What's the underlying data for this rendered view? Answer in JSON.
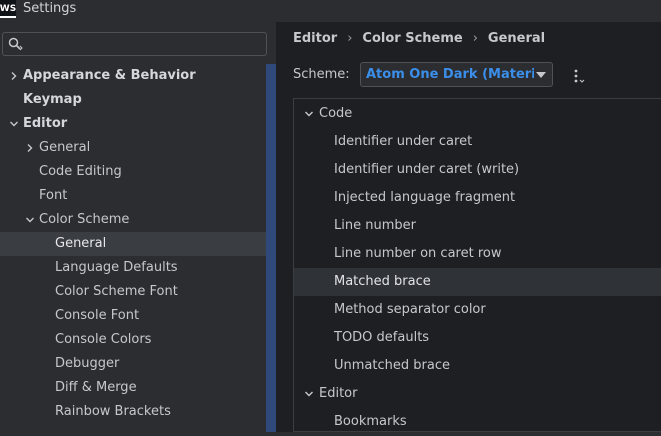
{
  "window": {
    "title": "Settings",
    "logo_text": "WS"
  },
  "search": {
    "placeholder": "",
    "value": ""
  },
  "tree": [
    {
      "label": "Appearance & Behavior",
      "bold": true,
      "chevron": "right"
    },
    {
      "label": "Keymap",
      "bold": true,
      "chevron": ""
    },
    {
      "label": "Editor",
      "bold": true,
      "chevron": "down"
    },
    {
      "label": "General",
      "bold": false,
      "chevron": "right"
    },
    {
      "label": "Code Editing",
      "bold": false,
      "chevron": ""
    },
    {
      "label": "Font",
      "bold": false,
      "chevron": ""
    },
    {
      "label": "Color Scheme",
      "bold": false,
      "chevron": "down"
    },
    {
      "label": "General",
      "bold": false,
      "chevron": "",
      "selected": true
    },
    {
      "label": "Language Defaults",
      "bold": false,
      "chevron": ""
    },
    {
      "label": "Color Scheme Font",
      "bold": false,
      "chevron": ""
    },
    {
      "label": "Console Font",
      "bold": false,
      "chevron": ""
    },
    {
      "label": "Console Colors",
      "bold": false,
      "chevron": ""
    },
    {
      "label": "Debugger",
      "bold": false,
      "chevron": ""
    },
    {
      "label": "Diff & Merge",
      "bold": false,
      "chevron": ""
    },
    {
      "label": "Rainbow Brackets",
      "bold": false,
      "chevron": ""
    }
  ],
  "breadcrumb": [
    "Editor",
    "Color Scheme",
    "General"
  ],
  "scheme": {
    "label": "Scheme:",
    "value": "Atom One Dark (Material"
  },
  "sections": [
    {
      "label": "Code",
      "type": "group"
    },
    {
      "label": "Identifier under caret",
      "type": "item"
    },
    {
      "label": "Identifier under caret (write)",
      "type": "item"
    },
    {
      "label": "Injected language fragment",
      "type": "item"
    },
    {
      "label": "Line number",
      "type": "item"
    },
    {
      "label": "Line number on caret row",
      "type": "item"
    },
    {
      "label": "Matched brace",
      "type": "item",
      "selected": true
    },
    {
      "label": "Method separator color",
      "type": "item"
    },
    {
      "label": "TODO defaults",
      "type": "item"
    },
    {
      "label": "Unmatched brace",
      "type": "item"
    },
    {
      "label": "Editor",
      "type": "group"
    },
    {
      "label": "Bookmarks",
      "type": "item"
    }
  ],
  "colors": {
    "accent": "#3b8eea",
    "selection": "#3a3d42",
    "scrollbar": "#2f4a7a"
  }
}
